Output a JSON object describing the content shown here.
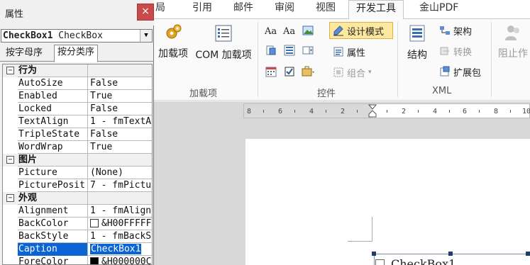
{
  "ribbon": {
    "tabs": [
      {
        "label": "布局",
        "partial_label": "局"
      },
      {
        "label": "引用"
      },
      {
        "label": "邮件"
      },
      {
        "label": "审阅"
      },
      {
        "label": "视图"
      },
      {
        "label": "开发工具",
        "active": true
      },
      {
        "label": "金山PDF"
      }
    ],
    "groups": {
      "addins": {
        "label": "加载项",
        "buttons": {
          "addins": "加载项",
          "com_addins": "COM 加载项"
        }
      },
      "controls": {
        "label": "控件",
        "design_mode": "设计模式",
        "properties": "属性",
        "group": "组合",
        "text_icons": [
          "Aa",
          "Aa"
        ]
      },
      "xml": {
        "label": "XML",
        "structure": "结构",
        "schema": "架构",
        "transform": "转换",
        "expansion": "扩展包"
      },
      "protect": {
        "block_authors_partial": "阻止作"
      }
    }
  },
  "ruler": {
    "labels": [
      "8",
      "6",
      "4",
      "2",
      "2",
      "4",
      "6",
      "8",
      "10"
    ]
  },
  "document": {
    "checkbox_caption": "CheckBox1"
  },
  "properties": {
    "title": "属性",
    "close_glyph": "×",
    "object_name": "CheckBox1",
    "object_type": "CheckBox",
    "tabs": [
      "按字母序",
      "按分类序"
    ],
    "rows": [
      {
        "type": "category",
        "name": "行为",
        "toggle": "⊟"
      },
      {
        "name": "AutoSize",
        "value": "False"
      },
      {
        "name": "Enabled",
        "value": "True"
      },
      {
        "name": "Locked",
        "value": "False"
      },
      {
        "name": "TextAlign",
        "value": "1 - fmTextA"
      },
      {
        "name": "TripleState",
        "value": "False"
      },
      {
        "name": "WordWrap",
        "value": "True"
      },
      {
        "type": "category",
        "name": "图片",
        "toggle": "⊟"
      },
      {
        "name": "Picture",
        "value": "(None)"
      },
      {
        "name": "PicturePosit",
        "value": "7 - fmPictu"
      },
      {
        "type": "category",
        "name": "外观",
        "toggle": "⊟"
      },
      {
        "name": "Alignment",
        "value": "1 - fmAlign"
      },
      {
        "name": "BackColor",
        "value": "&H00FFFFF",
        "swatch": "#ffffff"
      },
      {
        "name": "BackStyle",
        "value": "1 - fmBackS"
      },
      {
        "name": "Caption",
        "value": "CheckBox1",
        "selected": true
      },
      {
        "name": "ForeColor",
        "value": "&H000000C",
        "swatch": "#000000"
      }
    ]
  },
  "colors": {
    "selection": "#0a64d3",
    "close_button": "#c94a4a",
    "design_mode_highlight": "#fde8a0"
  }
}
